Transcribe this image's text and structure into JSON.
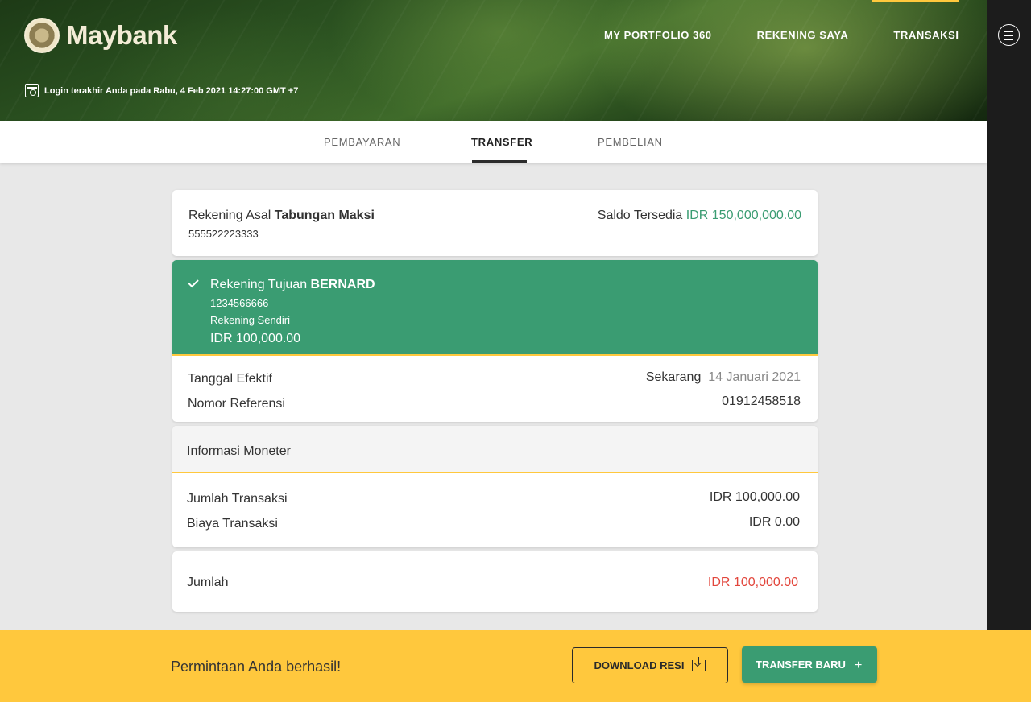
{
  "brand": {
    "logo_text": "Maybank"
  },
  "nav": {
    "items": [
      {
        "label": "MY PORTFOLIO 360"
      },
      {
        "label": "REKENING SAYA"
      },
      {
        "label": "TRANSAKSI"
      }
    ]
  },
  "last_login": "Login terakhir Anda pada Rabu, 4 Feb 2021 14:27:00 GMT +7",
  "tabs": [
    {
      "label": "PEMBAYARAN",
      "active": false
    },
    {
      "label": "TRANSFER",
      "active": true
    },
    {
      "label": "PEMBELIAN",
      "active": false
    }
  ],
  "source_account": {
    "label": "Rekening Asal",
    "name": "Tabungan Maksi",
    "number": "555522223333",
    "balance_label": "Saldo Tersedia",
    "balance": "IDR 150,000,000.00"
  },
  "destination_account": {
    "label": "Rekening Tujuan",
    "name": "BERNARD",
    "number": "1234566666",
    "type": "Rekening Sendiri",
    "amount": "IDR 100,000.00"
  },
  "schedule": {
    "effective_date_label": "Tanggal Efektif",
    "effective_when": "Sekarang",
    "effective_date": "14 Januari 2021",
    "reference_label": "Nomor Referensi",
    "reference_number": "01912458518"
  },
  "monetary_info": {
    "title": "Informasi Moneter",
    "amount_label": "Jumlah Transaksi",
    "amount": "IDR 100,000.00",
    "fee_label": "Biaya Transaksi",
    "fee": "IDR 0.00"
  },
  "total": {
    "label": "Jumlah",
    "value": "IDR 100,000.00"
  },
  "footer": {
    "message": "Permintaan Anda berhasil!",
    "download_label": "DOWNLOAD RESI",
    "new_transfer_label": "TRANSFER BARU",
    "new_transfer_icon": "+"
  },
  "colors": {
    "brand_green": "#3a9c72",
    "accent_yellow": "#ffc83d",
    "total_red": "#e2463c"
  }
}
